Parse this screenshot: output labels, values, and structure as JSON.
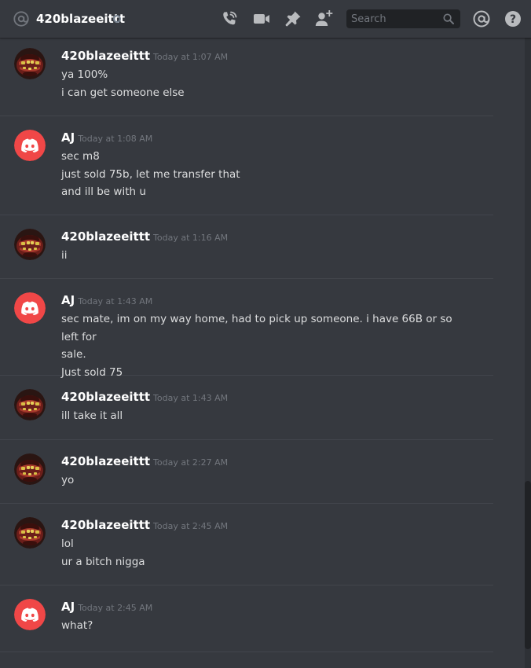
{
  "header": {
    "channel_name": "420blazeeittt",
    "status": "offline",
    "search_placeholder": "Search",
    "icons": [
      "at-sign-icon",
      "call-icon",
      "video-icon",
      "pin-icon",
      "add-friend-icon",
      "search-icon",
      "mention-icon",
      "help-icon"
    ]
  },
  "colors": {
    "background": "#36393f",
    "discord_avatar": "#f04747",
    "timestamp": "#72767d",
    "text": "#dcddde"
  },
  "messages": [
    {
      "author": "420blazeeittt",
      "avatar": "skull-avatar",
      "timestamp": "Today at 1:07 AM",
      "lines": [
        "ya 100%",
        "i can get someone else"
      ]
    },
    {
      "author": "AJ",
      "avatar": "discord-avatar",
      "timestamp": "Today at 1:08 AM",
      "lines": [
        "sec m8",
        "just sold 75b, let me transfer that",
        "and ill be with u"
      ]
    },
    {
      "author": "420blazeeittt",
      "avatar": "skull-avatar",
      "timestamp": "Today at 1:16 AM",
      "lines": [
        "ii"
      ]
    },
    {
      "author": "AJ",
      "avatar": "discord-avatar",
      "timestamp": "Today at 1:43 AM",
      "lines": [
        "sec mate, im on my way home, had to pick up someone. i have 66B or so left for",
        "sale.",
        "Just sold 75"
      ]
    },
    {
      "author": "420blazeeittt",
      "avatar": "skull-avatar",
      "timestamp": "Today at 1:43 AM",
      "lines": [
        "ill take it all"
      ]
    },
    {
      "author": "420blazeeittt",
      "avatar": "skull-avatar",
      "timestamp": "Today at 2:27 AM",
      "lines": [
        "yo"
      ]
    },
    {
      "author": "420blazeeittt",
      "avatar": "skull-avatar",
      "timestamp": "Today at 2:45 AM",
      "lines": [
        "lol",
        "ur a bitch nigga"
      ]
    },
    {
      "author": "AJ",
      "avatar": "discord-avatar",
      "timestamp": "Today at 2:45 AM",
      "lines": [
        "what?"
      ]
    }
  ]
}
